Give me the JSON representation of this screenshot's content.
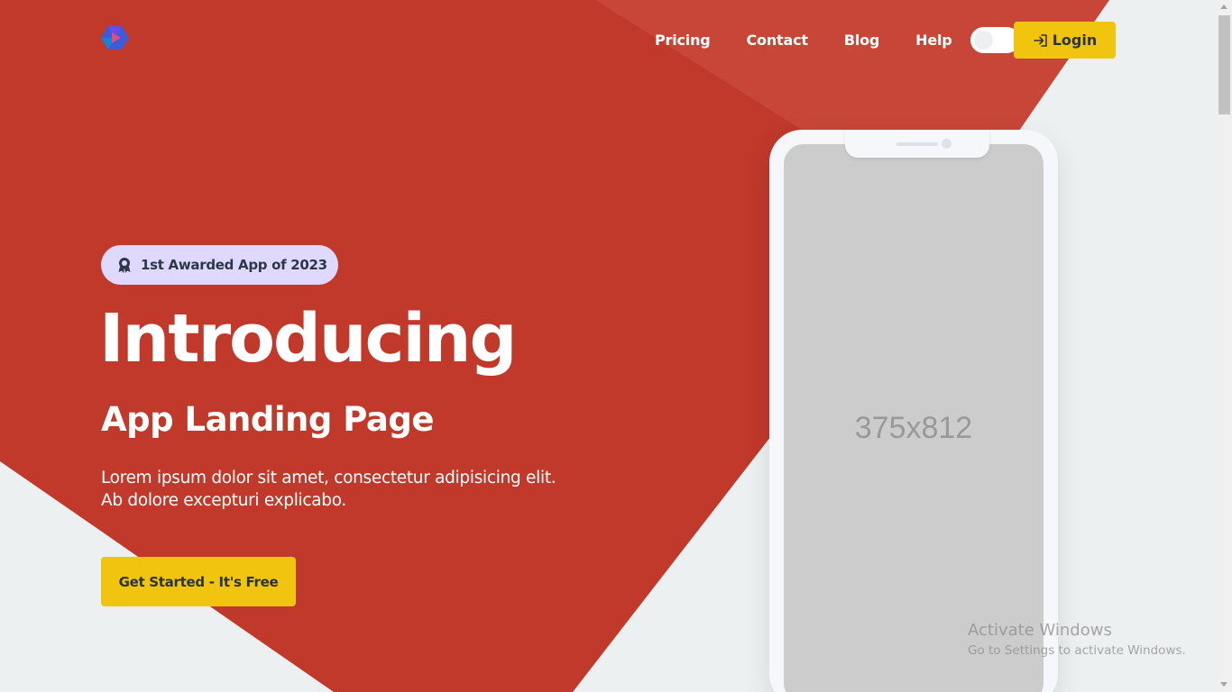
{
  "colors": {
    "primary_red": "#c0392b",
    "accent_yellow": "#f1c40f",
    "badge_bg": "#e0d9ff",
    "background": "#ecf0f1"
  },
  "header": {
    "logo_icon": "app-logo-icon",
    "nav": [
      "Pricing",
      "Contact",
      "Blog",
      "Help"
    ],
    "theme_toggle": "theme-toggle",
    "login_label": "Login",
    "login_icon": "login-arrow-icon"
  },
  "hero": {
    "badge_icon": "award-ribbon-icon",
    "badge_text": "1st Awarded App of 2023",
    "title": "Introducing",
    "subtitle": "App Landing Page",
    "description": "Lorem ipsum dolor sit amet, consectetur adipisicing elit. Ab dolore excepturi explicabo.",
    "cta_label": "Get Started - It's Free"
  },
  "phone": {
    "screen_placeholder": "375x812"
  },
  "watermark": {
    "title": "Activate Windows",
    "subtitle": "Go to Settings to activate Windows."
  }
}
